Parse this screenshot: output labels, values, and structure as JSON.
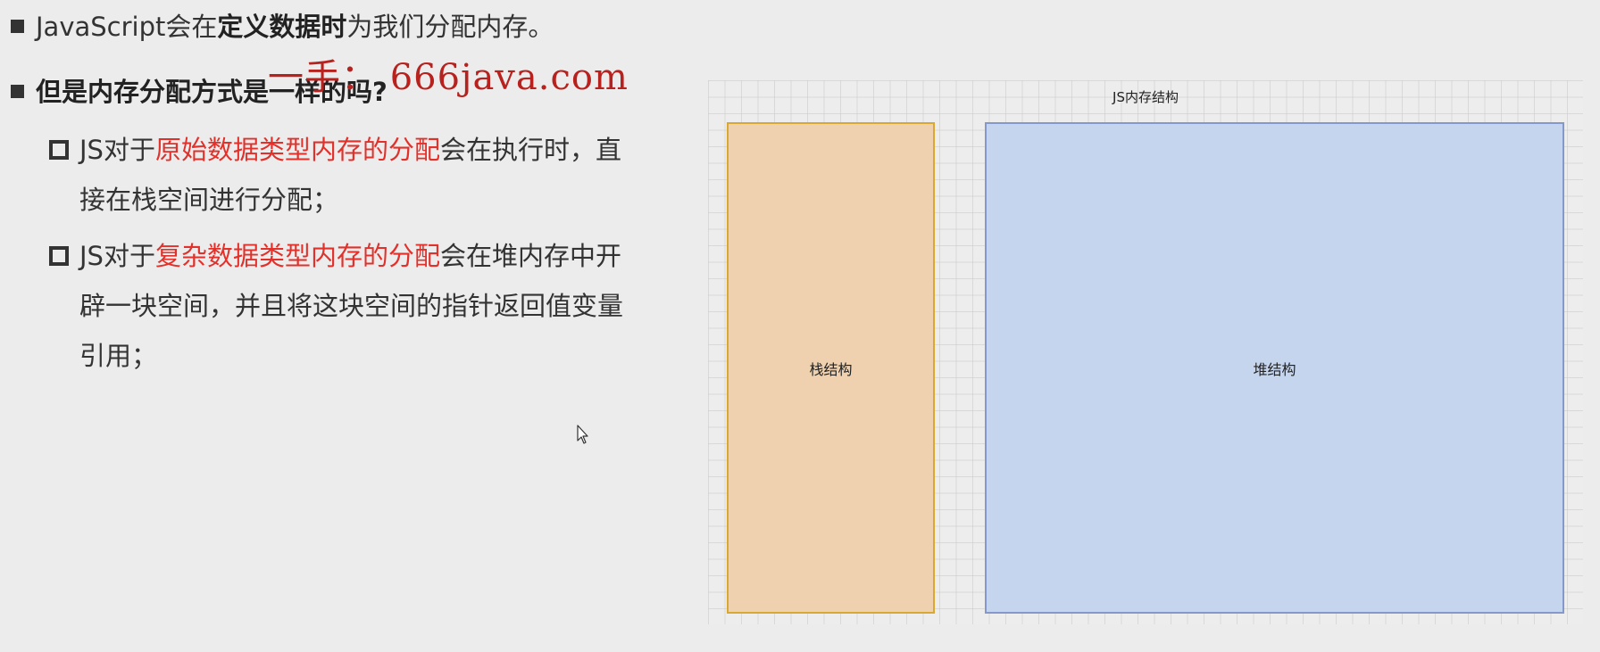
{
  "bullets": {
    "b1": {
      "prefix": "JavaScript会在",
      "bold": "定义数据时",
      "suffix": "为我们分配内存。"
    },
    "b2": {
      "text": "但是内存分配方式是一样的吗?"
    },
    "sub1": {
      "prefix": "JS对于",
      "highlight": "原始数据类型内存的分配",
      "suffix": "会在执行时，直接在栈空间进行分配；"
    },
    "sub2": {
      "prefix": "JS对于",
      "highlight": "复杂数据类型内存的分配",
      "suffix": "会在堆内存中开辟一块空间，并且将这块空间的指针返回值变量引用；"
    }
  },
  "watermark": "一手： 666java.com",
  "diagram": {
    "title": "JS内存结构",
    "stack_label": "栈结构",
    "heap_label": "堆结构"
  },
  "colors": {
    "highlight": "#e2302a",
    "watermark": "#b8221e",
    "stack_fill": "#efd1b0",
    "stack_border": "#d9a832",
    "heap_fill": "#c5d5ee",
    "heap_border": "#8598cc"
  }
}
